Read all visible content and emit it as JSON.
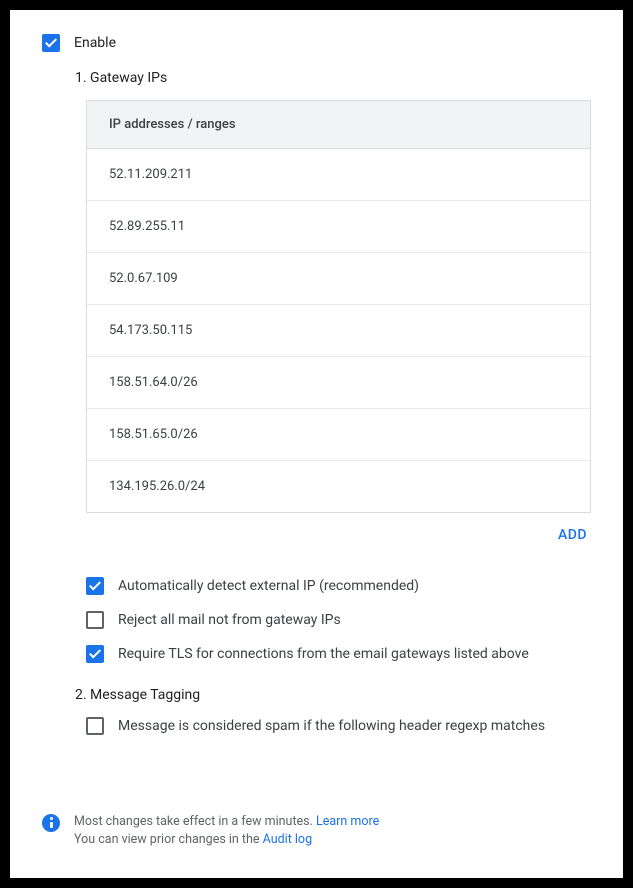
{
  "enable": {
    "label": "Enable",
    "checked": true
  },
  "sections": {
    "gateway": {
      "title": "1. Gateway IPs",
      "table_header": "IP addresses / ranges",
      "rows": [
        "52.11.209.211",
        "52.89.255.11",
        "52.0.67.109",
        "54.173.50.115",
        "158.51.64.0/26",
        "158.51.65.0/26",
        "134.195.26.0/24"
      ],
      "add_label": "ADD",
      "options": [
        {
          "label": "Automatically detect external IP (recommended)",
          "checked": true
        },
        {
          "label": "Reject all mail not from gateway IPs",
          "checked": false
        },
        {
          "label": "Require TLS for connections from the email gateways listed above",
          "checked": true
        }
      ]
    },
    "tagging": {
      "title": "2. Message Tagging",
      "options": [
        {
          "label": "Message is considered spam if the following header regexp matches",
          "checked": false
        }
      ]
    }
  },
  "footer": {
    "line1a": "Most changes take effect in a few minutes. ",
    "learn_more": "Learn more",
    "line2a": "You can view prior changes in the ",
    "audit_log": "Audit log"
  }
}
